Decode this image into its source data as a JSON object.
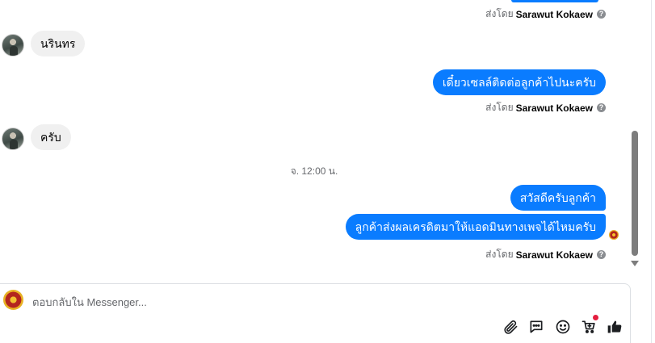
{
  "thread": {
    "messages": [
      {
        "side": "in",
        "text": "นรินทร"
      },
      {
        "side": "out",
        "text": "เดี๋ยวเซลล์ติดต่อลูกค้าไปนะครับ"
      },
      {
        "side": "in",
        "text": "ครับ"
      },
      {
        "side": "out",
        "text": "สวัสดีครับลูกค้า"
      },
      {
        "side": "out",
        "text": "ลูกค้าส่งผลเครดิตมาให้แอดมินทางเพจได้ไหมครับ"
      }
    ],
    "sent_by_label": "ส่งโดย",
    "sent_by_name": "Sarawut Kokaew",
    "help_glyph": "?",
    "timestamp": "จ. 12:00 น."
  },
  "composer": {
    "placeholder": "ตอบกลับใน Messenger..."
  },
  "icons": {
    "attach": "paperclip-icon",
    "saved_replies": "chat-bubble-icon",
    "emoji": "smiley-icon",
    "shop": "cart-icon",
    "like": "thumbs-up-icon"
  },
  "colors": {
    "accent": "#0a7cff",
    "incoming_bubble": "#f0f0f0",
    "secondary_text": "#65676b",
    "notification_dot": "#e41e3f"
  }
}
